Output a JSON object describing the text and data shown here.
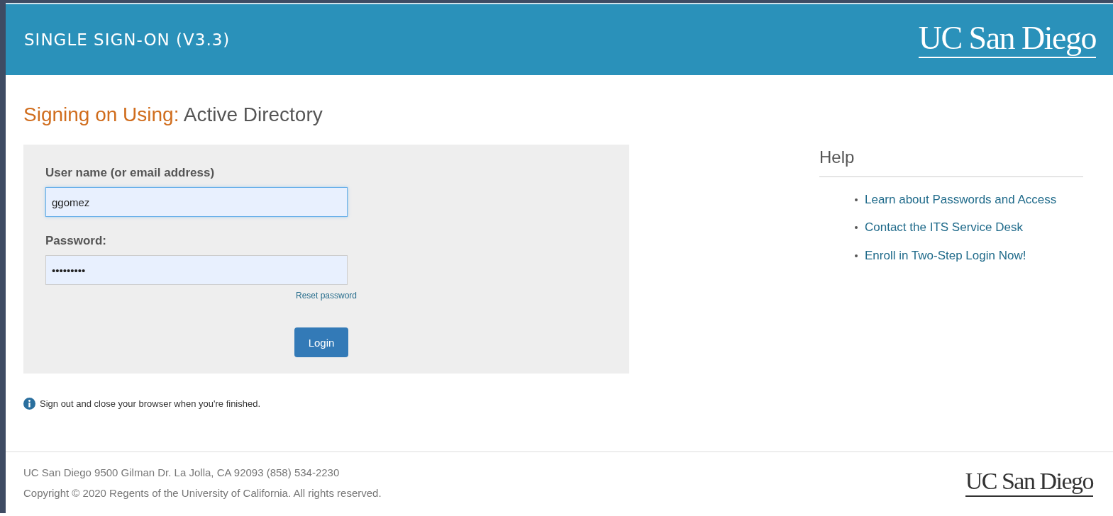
{
  "header": {
    "title": "SINGLE SIGN-ON (V3.3)",
    "logo": "UC San Diego"
  },
  "heading": {
    "prefix": "Signing on Using:",
    "value": "Active Directory"
  },
  "form": {
    "username_label": "User name (or email address)",
    "username_value": "ggomez",
    "username_focused": true,
    "password_label": "Password:",
    "password_value": "•••••••••",
    "reset_link": "Reset password",
    "login_button": "Login"
  },
  "notice": "Sign out and close your browser when you're finished.",
  "help": {
    "title": "Help",
    "links": [
      "Learn about Passwords and Access",
      "Contact the ITS Service Desk",
      "Enroll in Two-Step Login Now!"
    ]
  },
  "footer": {
    "address": "UC San Diego 9500 Gilman Dr. La Jolla, CA 92093 (858) 534-2230",
    "copyright": "Copyright © 2020 Regents of the University of California. All rights reserved.",
    "logo": "UC San Diego"
  }
}
